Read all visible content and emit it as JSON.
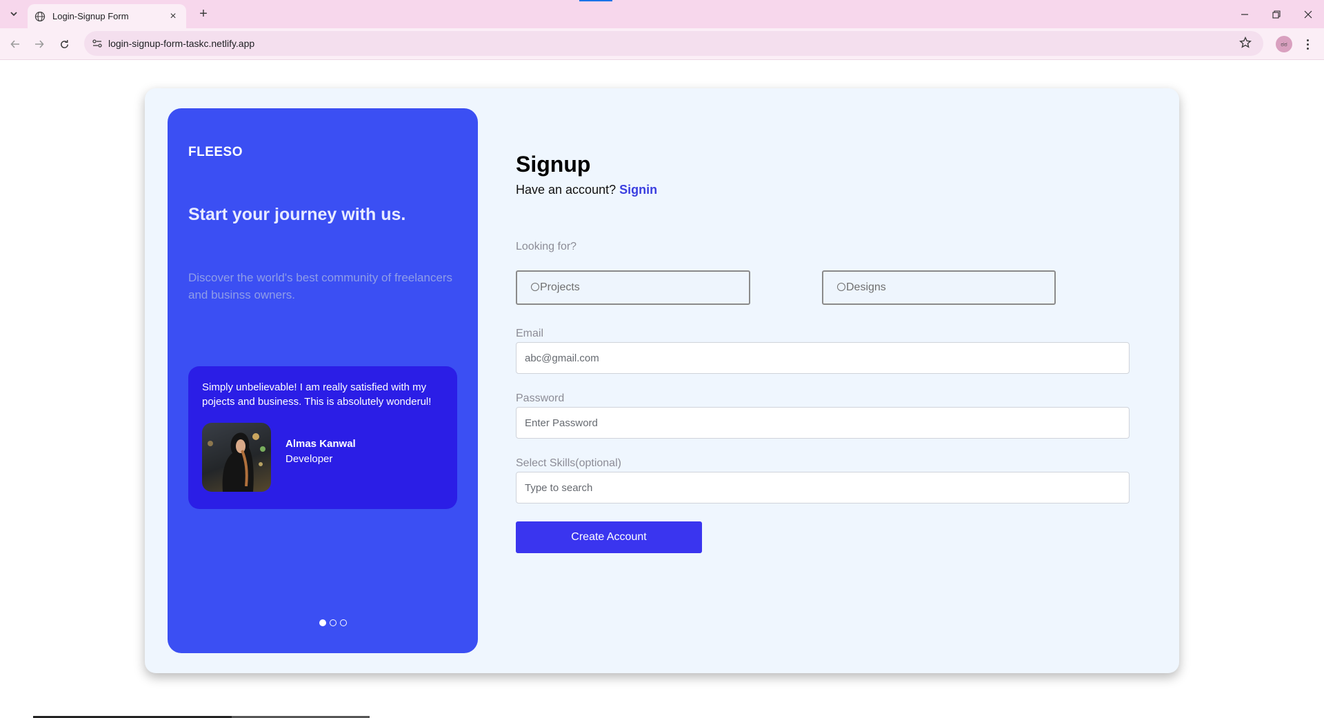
{
  "browser": {
    "tab_title": "Login-Signup Form",
    "url": "login-signup-form-taskc.netlify.app",
    "profile_label": "ಠಠ"
  },
  "promo": {
    "brand": "FLEESO",
    "headline": "Start your journey with us.",
    "subcopy": "Discover the world's best community of freelancers and businss owners.",
    "testimonial": {
      "quote": "Simply unbelievable! I am really satisfied with my pojects and business. This is absolutely wonderul!",
      "name": "Almas Kanwal",
      "role": "Developer"
    },
    "carousel": {
      "total": 3,
      "active": 1
    }
  },
  "form": {
    "title": "Signup",
    "have_account_text": "Have an account?",
    "signin_label": "Signin",
    "looking_for_label": "Looking for?",
    "options": [
      {
        "label": "Projects"
      },
      {
        "label": "Designs"
      }
    ],
    "email": {
      "label": "Email",
      "placeholder": "abc@gmail.com"
    },
    "password": {
      "label": "Password",
      "placeholder": "Enter Password"
    },
    "skills": {
      "label": "Select Skills(optional)",
      "placeholder": "Type to search"
    },
    "submit_label": "Create Account"
  },
  "colors": {
    "promo_bg": "#3b4ff3",
    "testimonial_bg": "#2b1ee6",
    "button": "#3a35ef",
    "link": "#3b3fe0",
    "card_bg": "#eff6fe"
  }
}
